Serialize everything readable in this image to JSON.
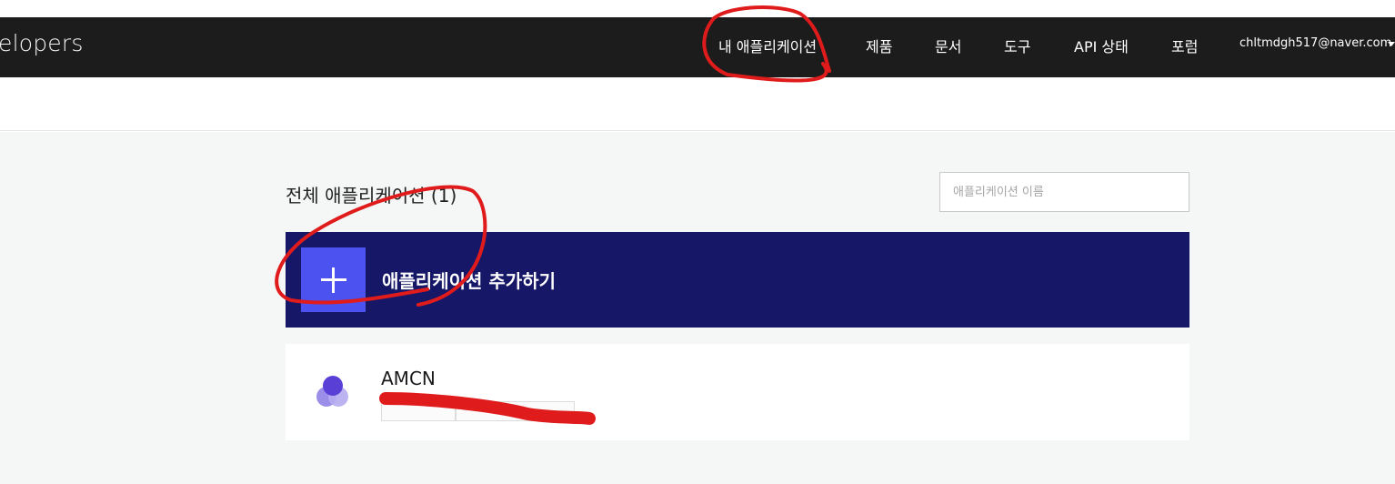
{
  "navbar": {
    "brand": "elopers",
    "items": [
      {
        "label": "내 애플리케이션"
      },
      {
        "label": "제품"
      },
      {
        "label": "문서"
      },
      {
        "label": "도구"
      },
      {
        "label": "API 상태"
      },
      {
        "label": "포럼"
      }
    ],
    "user_email": "chltmdgh517@naver.com"
  },
  "main": {
    "section_title": "전체 애플리케이션 (1)",
    "search_placeholder": "애플리케이션 이름",
    "add_button_label": "애플리케이션 추가하기",
    "apps": [
      {
        "name": "AMCN"
      }
    ]
  },
  "colors": {
    "navbar_bg": "#1c1c1c",
    "add_bg": "#161767",
    "add_accent": "#4c52f0",
    "annotation": "#e01b1b"
  }
}
